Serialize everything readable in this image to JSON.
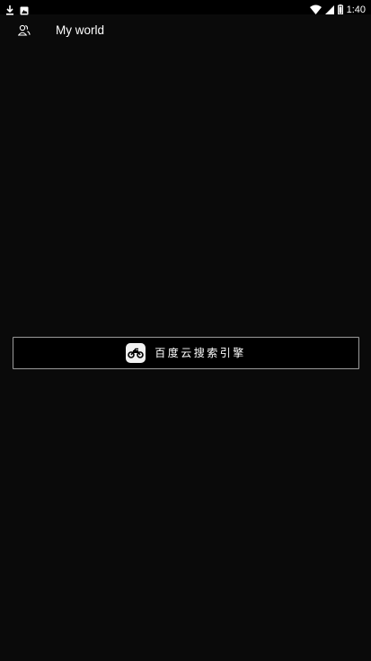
{
  "status_bar": {
    "time": "1:40",
    "left_icons": [
      "download-icon",
      "image-notification-icon"
    ],
    "right_icons": [
      "wifi-icon",
      "cell-signal-icon",
      "battery-icon"
    ]
  },
  "app_bar": {
    "title": "My world",
    "icon": "profile-icon"
  },
  "search_engine": {
    "label": "百度云搜索引擎",
    "logo": "motorcycle-logo-icon"
  },
  "colors": {
    "background": "#0a0a0a",
    "status_bar": "#000000",
    "button_border": "#9a9a9a",
    "text": "#ffffff"
  }
}
